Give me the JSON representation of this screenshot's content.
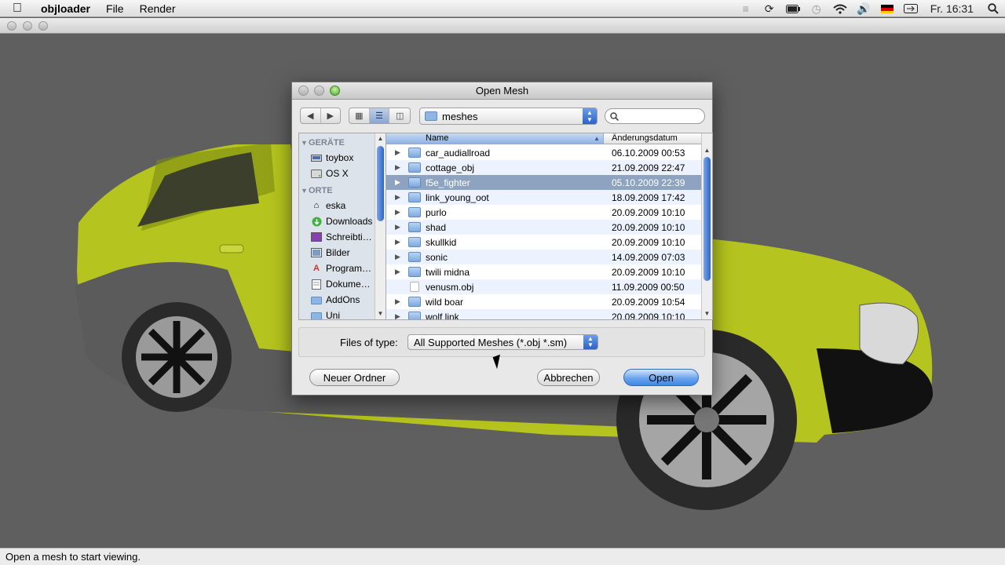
{
  "menubar": {
    "app_name": "objloader",
    "menus": [
      "File",
      "Render"
    ],
    "clock": "Fr. 16:31",
    "status_icons": [
      "scripts-icon",
      "sync-icon",
      "battery-icon",
      "time-machine-icon",
      "wifi-icon",
      "volume-icon",
      "flag-de-icon",
      "input-icon",
      "spotlight-icon"
    ]
  },
  "dialog": {
    "title": "Open Mesh",
    "location": "meshes",
    "search_placeholder": "",
    "sidebar": {
      "sections": [
        {
          "title": "GERÄTE",
          "items": [
            {
              "label": "toybox",
              "icon": "drive-icon"
            },
            {
              "label": "OS X",
              "icon": "disk-icon"
            }
          ]
        },
        {
          "title": "ORTE",
          "items": [
            {
              "label": "eska",
              "icon": "home-icon"
            },
            {
              "label": "Downloads",
              "icon": "downloads-icon"
            },
            {
              "label": "Schreibti…",
              "icon": "desktop-icon"
            },
            {
              "label": "Bilder",
              "icon": "pictures-icon"
            },
            {
              "label": "Program…",
              "icon": "applications-icon"
            },
            {
              "label": "Dokume…",
              "icon": "documents-icon"
            },
            {
              "label": "AddOns",
              "icon": "folder-icon"
            },
            {
              "label": "Uni",
              "icon": "folder-icon"
            }
          ]
        }
      ]
    },
    "columns": {
      "name": "Name",
      "date": "Änderungsdatum"
    },
    "files": [
      {
        "name": "car_audiallroad",
        "date": "06.10.2009 00:53",
        "type": "folder",
        "selected": false
      },
      {
        "name": "cottage_obj",
        "date": "21.09.2009 22:47",
        "type": "folder",
        "selected": false
      },
      {
        "name": "f5e_fighter",
        "date": "05.10.2009 22:39",
        "type": "folder",
        "selected": true
      },
      {
        "name": "link_young_oot",
        "date": "18.09.2009 17:42",
        "type": "folder",
        "selected": false
      },
      {
        "name": "purlo",
        "date": "20.09.2009 10:10",
        "type": "folder",
        "selected": false
      },
      {
        "name": "shad",
        "date": "20.09.2009 10:10",
        "type": "folder",
        "selected": false
      },
      {
        "name": "skullkid",
        "date": "20.09.2009 10:10",
        "type": "folder",
        "selected": false
      },
      {
        "name": "sonic",
        "date": "14.09.2009 07:03",
        "type": "folder",
        "selected": false
      },
      {
        "name": "twili midna",
        "date": "20.09.2009 10:10",
        "type": "folder",
        "selected": false
      },
      {
        "name": "venusm.obj",
        "date": "11.09.2009 00:50",
        "type": "file",
        "selected": false
      },
      {
        "name": "wild boar",
        "date": "20.09.2009 10:54",
        "type": "folder",
        "selected": false
      },
      {
        "name": "wolf link",
        "date": "20.09.2009 10:10",
        "type": "folder",
        "selected": false
      }
    ],
    "files_of_type_label": "Files of type:",
    "files_of_type_value": "All Supported Meshes (*.obj *.sm)",
    "buttons": {
      "new_folder": "Neuer Ordner",
      "cancel": "Abbrechen",
      "open": "Open"
    }
  },
  "status": "Open a mesh to start viewing.",
  "colors": {
    "car_body": "#b5c41e",
    "selection": "#8da3c0",
    "accent": "#3f86e3"
  }
}
